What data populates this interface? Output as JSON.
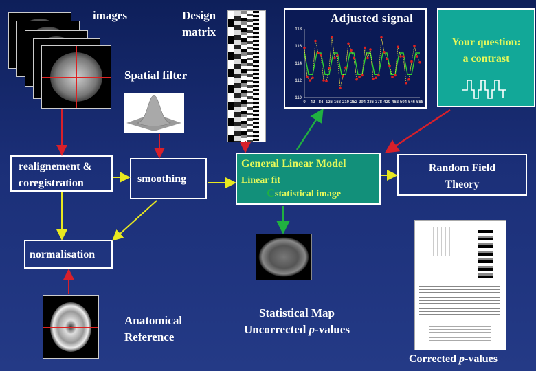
{
  "labels": {
    "images": "images",
    "design_matrix": [
      "Design",
      "matrix"
    ],
    "spatial_filter": "Spatial filter",
    "adjusted_signal": "Adjusted signal",
    "question": [
      "Your question:",
      "a contrast"
    ],
    "realignment": [
      "realignement &",
      "coregistration"
    ],
    "smoothing": "smoothing",
    "glm_title": "General Linear Model",
    "glm_fit": "Linear fit",
    "glm_stat": "statistical image",
    "rft": [
      "Random Field",
      "Theory"
    ],
    "normalisation": "normalisation",
    "anatomical": [
      "Anatomical",
      "Reference"
    ],
    "stat_map": [
      "Statistical Map",
      "Uncorrected "
    ],
    "stat_map_p": "p",
    "stat_map_tail": "-values",
    "corrected": "Corrected ",
    "corrected_p": "p",
    "corrected_tail": "-values"
  },
  "colors": {
    "background": "#1b2f78",
    "teal": "#12a898",
    "glm_box": "#12907a",
    "yellow_text": "#e4f85a",
    "red_arrow": "#d8202a",
    "yellow_arrow": "#e8e820",
    "green_arrow": "#20b040"
  },
  "chart_data": {
    "type": "line",
    "title": "Adjusted signal",
    "ylim": [
      110,
      118
    ],
    "yticks": [
      "110",
      "112",
      "114",
      "116",
      "118"
    ],
    "xlim": [
      0,
      588
    ],
    "xticks": [
      "0",
      "42",
      "84",
      "126",
      "168",
      "210",
      "252",
      "294",
      "336",
      "378",
      "420",
      "462",
      "504",
      "546",
      "588"
    ],
    "series": [
      {
        "kind": "fit",
        "color": "#30d030",
        "x": [
          0,
          21,
          42,
          63,
          84,
          105,
          126,
          147,
          168,
          189,
          210,
          231,
          252,
          273,
          294,
          315,
          336,
          357,
          378,
          399,
          420,
          441,
          462,
          483,
          504,
          525,
          546,
          567,
          588
        ],
        "values": [
          115.2,
          112.7,
          112.7,
          115.2,
          115.2,
          112.7,
          112.7,
          115.2,
          115.2,
          112.7,
          112.7,
          115.2,
          115.2,
          112.7,
          112.7,
          115.2,
          115.2,
          112.7,
          112.7,
          115.2,
          115.2,
          112.7,
          112.7,
          115.2,
          115.2,
          112.7,
          112.7,
          115.2,
          115.2
        ]
      },
      {
        "kind": "data",
        "color": "#e02020",
        "x": [
          0,
          14,
          28,
          42,
          56,
          70,
          84,
          98,
          112,
          126,
          140,
          154,
          168,
          182,
          196,
          210,
          224,
          238,
          252,
          266,
          280,
          294,
          308,
          322,
          336,
          350,
          364,
          378,
          392,
          406,
          420,
          434,
          448,
          462,
          476,
          490,
          504,
          518,
          532,
          546,
          560,
          574,
          588
        ],
        "values": [
          115.8,
          112.4,
          112.0,
          112.3,
          116.6,
          115.2,
          114.9,
          112.0,
          111.9,
          113.4,
          117.0,
          114.6,
          114.9,
          111.1,
          112.5,
          113.5,
          116.3,
          115.5,
          114.6,
          112.1,
          112.4,
          112.6,
          115.8,
          114.6,
          115.6,
          112.2,
          112.3,
          112.6,
          117.0,
          115.3,
          114.5,
          113.7,
          112.4,
          112.6,
          115.9,
          114.8,
          114.8,
          111.7,
          112.1,
          114.2,
          116.0,
          114.8,
          114.1
        ]
      }
    ]
  }
}
